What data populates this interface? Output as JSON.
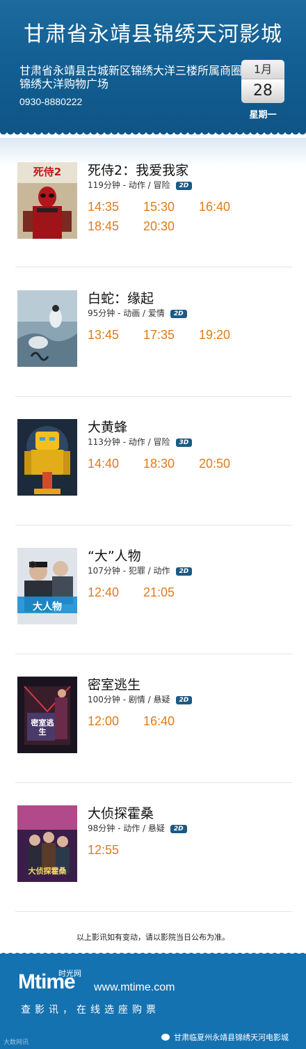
{
  "header": {
    "cinema_name": "甘肃省永靖县锦绣天河影城",
    "address": "甘肃省永靖县古城新区锦绣大洋三楼所属商圈锦绣大洋购物广场",
    "phone": "0930-8880222",
    "date": {
      "month": "1月",
      "day": "28",
      "weekday": "星期一"
    }
  },
  "movies": [
    {
      "title": "死侍2：我爱我家",
      "info": "119分钟 - 动作 / 冒险",
      "format": "2D",
      "times": [
        "14:35",
        "15:30",
        "16:40",
        "18:45",
        "20:30"
      ],
      "poster_text": "死侍2"
    },
    {
      "title": "白蛇：缘起",
      "info": "95分钟 - 动画 / 爱情",
      "format": "2D",
      "times": [
        "13:45",
        "17:35",
        "19:20"
      ],
      "poster_text": ""
    },
    {
      "title": "大黄蜂",
      "info": "113分钟 - 动作 / 冒险",
      "format": "3D",
      "times": [
        "14:40",
        "18:30",
        "20:50"
      ],
      "poster_text": ""
    },
    {
      "title": "“大”人物",
      "info": "107分钟 - 犯罪 / 动作",
      "format": "2D",
      "times": [
        "12:40",
        "21:05"
      ],
      "poster_text": "大人物"
    },
    {
      "title": "密室逃生",
      "info": "100分钟 - 剧情 / 悬疑",
      "format": "2D",
      "times": [
        "12:00",
        "16:40"
      ],
      "poster_text": "密室逃生"
    },
    {
      "title": "大侦探霍桑",
      "info": "98分钟 - 动作 / 悬疑",
      "format": "2D",
      "times": [
        "12:55"
      ],
      "poster_text": "大侦探霍桑"
    }
  ],
  "notice": "以上影讯如有变动，请以影院当日公布为准。",
  "footer": {
    "logo_m": "Mtime",
    "logo_cn": "时光网",
    "website": "www.mtime.com",
    "slogan": "查影讯，在线选座购票",
    "wechat": "甘肃临夏州永靖县锦绣天河电影城",
    "watermark": "大数网讯"
  },
  "colors": {
    "header_blue": "#135f93",
    "footer_blue": "#1572b0",
    "showtime_orange": "#e07b1a"
  }
}
